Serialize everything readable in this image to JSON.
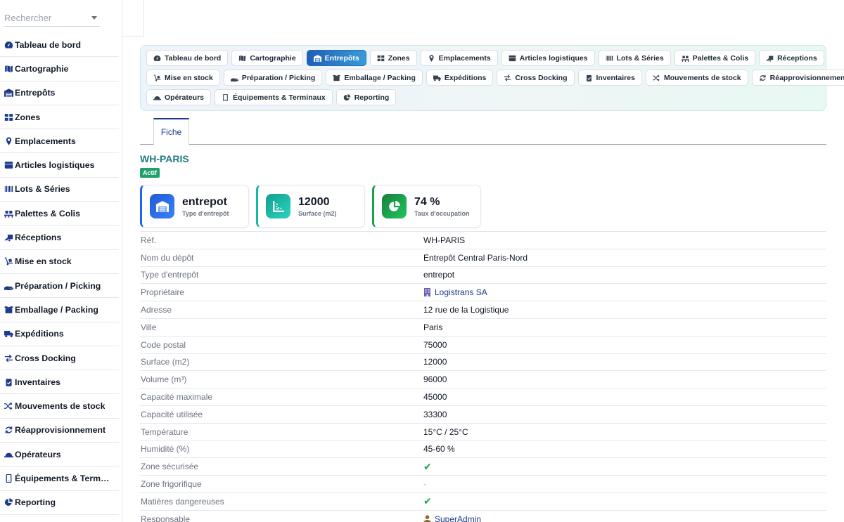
{
  "search": {
    "placeholder": "Rechercher"
  },
  "sidebar": {
    "items": [
      {
        "label": "Tableau de bord",
        "icon": "gauge-icon"
      },
      {
        "label": "Cartographie",
        "icon": "map-icon"
      },
      {
        "label": "Entrepôts",
        "icon": "warehouse-icon"
      },
      {
        "label": "Zones",
        "icon": "grid-icon"
      },
      {
        "label": "Emplacements",
        "icon": "pin-icon"
      },
      {
        "label": "Articles logistiques",
        "icon": "boxes-icon"
      },
      {
        "label": "Lots & Séries",
        "icon": "barcode-icon"
      },
      {
        "label": "Palettes & Colis",
        "icon": "pallet-icon"
      },
      {
        "label": "Réceptions",
        "icon": "truck-ramp-icon"
      },
      {
        "label": "Mise en stock",
        "icon": "dolly-icon"
      },
      {
        "label": "Préparation / Picking",
        "icon": "hand-icon"
      },
      {
        "label": "Emballage / Packing",
        "icon": "box-open-icon"
      },
      {
        "label": "Expéditions",
        "icon": "truck-icon"
      },
      {
        "label": "Cross Docking",
        "icon": "arrows-icon"
      },
      {
        "label": "Inventaires",
        "icon": "clipboard-check-icon"
      },
      {
        "label": "Mouvements de stock",
        "icon": "shuffle-icon"
      },
      {
        "label": "Réapprovisionnement",
        "icon": "rotate-icon"
      },
      {
        "label": "Opérateurs",
        "icon": "hard-hat-icon"
      },
      {
        "label": "Équipements & Term…",
        "icon": "mobile-icon"
      },
      {
        "label": "Reporting",
        "icon": "pie-chart-icon"
      }
    ]
  },
  "nav": {
    "rows": [
      [
        {
          "label": "Tableau de bord",
          "icon": "gauge-icon"
        },
        {
          "label": "Cartographie",
          "icon": "map-icon"
        },
        {
          "label": "Entrepôts",
          "icon": "warehouse-icon",
          "active": true
        },
        {
          "label": "Zones",
          "icon": "grid-icon"
        },
        {
          "label": "Emplacements",
          "icon": "pin-icon"
        },
        {
          "label": "Articles logistiques",
          "icon": "boxes-icon"
        },
        {
          "label": "Lots & Séries",
          "icon": "barcode-icon"
        },
        {
          "label": "Palettes & Colis",
          "icon": "pallet-icon"
        },
        {
          "label": "Réceptions",
          "icon": "truck-ramp-icon"
        }
      ],
      [
        {
          "label": "Mise en stock",
          "icon": "dolly-icon"
        },
        {
          "label": "Préparation / Picking",
          "icon": "hand-icon"
        },
        {
          "label": "Emballage / Packing",
          "icon": "box-open-icon"
        },
        {
          "label": "Expéditions",
          "icon": "truck-icon"
        },
        {
          "label": "Cross Docking",
          "icon": "arrows-icon"
        },
        {
          "label": "Inventaires",
          "icon": "clipboard-check-icon"
        },
        {
          "label": "Mouvements de stock",
          "icon": "shuffle-icon"
        },
        {
          "label": "Réapprovisionnement",
          "icon": "rotate-icon"
        }
      ],
      [
        {
          "label": "Opérateurs",
          "icon": "hard-hat-icon"
        },
        {
          "label": "Équipements & Terminaux",
          "icon": "mobile-icon"
        },
        {
          "label": "Reporting",
          "icon": "pie-chart-icon"
        }
      ]
    ]
  },
  "tabs": {
    "fiche": "Fiche"
  },
  "record": {
    "title": "WH-PARIS",
    "status": "Actif"
  },
  "cards": [
    {
      "value": "entrepot",
      "label": "Type d'entrepôt",
      "icon": "warehouse-icon"
    },
    {
      "value": "12000",
      "label": "Surface (m2)",
      "icon": "ruler-icon"
    },
    {
      "value": "74 %",
      "label": "Taux d'occupation",
      "icon": "pie-chart-icon"
    }
  ],
  "fields": [
    {
      "label": "Réf.",
      "value": "WH-PARIS"
    },
    {
      "label": "Nom du dépôt",
      "value": "Entrepôt Central Paris-Nord"
    },
    {
      "label": "Type d'entrepôt",
      "value": "entrepot"
    },
    {
      "label": "Propriétaire",
      "value": "Logistrans SA",
      "kind": "company-link"
    },
    {
      "label": "Adresse",
      "value": "12 rue de la Logistique"
    },
    {
      "label": "Ville",
      "value": "Paris"
    },
    {
      "label": "Code postal",
      "value": "75000"
    },
    {
      "label": "Surface (m2)",
      "value": "12000"
    },
    {
      "label": "Volume (m³)",
      "value": "96000"
    },
    {
      "label": "Capacité maximale",
      "value": "45000"
    },
    {
      "label": "Capacité utilisée",
      "value": "33300"
    },
    {
      "label": "Température",
      "value": "15°C / 25°C"
    },
    {
      "label": "Humidité (%)",
      "value": "45-60 %"
    },
    {
      "label": "Zone sécurisée",
      "value": "✔",
      "kind": "check"
    },
    {
      "label": "Zone frigorifique",
      "value": "-",
      "kind": "dash"
    },
    {
      "label": "Matières dangereuses",
      "value": "✔",
      "kind": "check"
    },
    {
      "label": "Responsable",
      "value": "SuperAdmin",
      "kind": "user-link"
    }
  ],
  "colors": {
    "primary": "#1e3a8a",
    "accent_teal": "#1f7a86",
    "success": "#22a06b"
  }
}
